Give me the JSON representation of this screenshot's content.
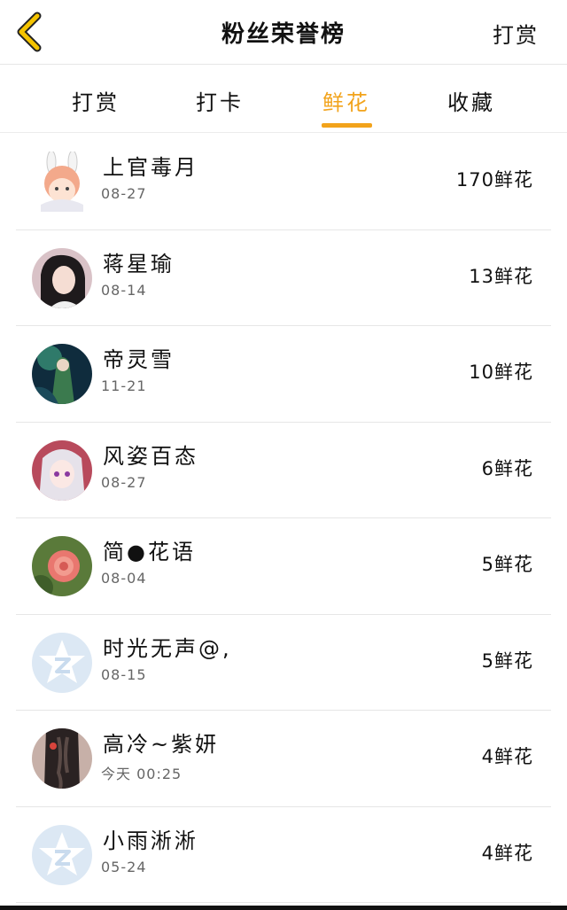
{
  "header": {
    "title": "粉丝荣誉榜",
    "right_action": "打赏"
  },
  "tabs": [
    {
      "label": "打赏",
      "active": false
    },
    {
      "label": "打卡",
      "active": false
    },
    {
      "label": "鲜花",
      "active": true
    },
    {
      "label": "收藏",
      "active": false
    }
  ],
  "colors": {
    "accent": "#f2a31b",
    "back_icon": "#f5c400"
  },
  "fans": [
    {
      "name": "上官毒月",
      "date": "08-27",
      "amount": "170鲜花",
      "avatar": "anime-bunny-avatar"
    },
    {
      "name": "蒋星瑜",
      "date": "08-14",
      "amount": "13鲜花",
      "avatar": "girl-photo-avatar"
    },
    {
      "name": "帝灵雪",
      "date": "11-21",
      "amount": "10鲜花",
      "avatar": "anime-green-avatar"
    },
    {
      "name": "风姿百态",
      "date": "08-27",
      "amount": "6鲜花",
      "avatar": "anime-pink-avatar"
    },
    {
      "name": "简●花语",
      "date": "08-04",
      "amount": "5鲜花",
      "avatar": "flower-avatar"
    },
    {
      "name": "时光无声@,",
      "date": "08-15",
      "amount": "5鲜花",
      "avatar": "default-qq-avatar"
    },
    {
      "name": "高冷~紫妍",
      "date": "今天 00:25",
      "amount": "4鲜花",
      "avatar": "braid-photo-avatar"
    },
    {
      "name": "小雨淅淅",
      "date": "05-24",
      "amount": "4鲜花",
      "avatar": "default-qq-avatar"
    }
  ]
}
